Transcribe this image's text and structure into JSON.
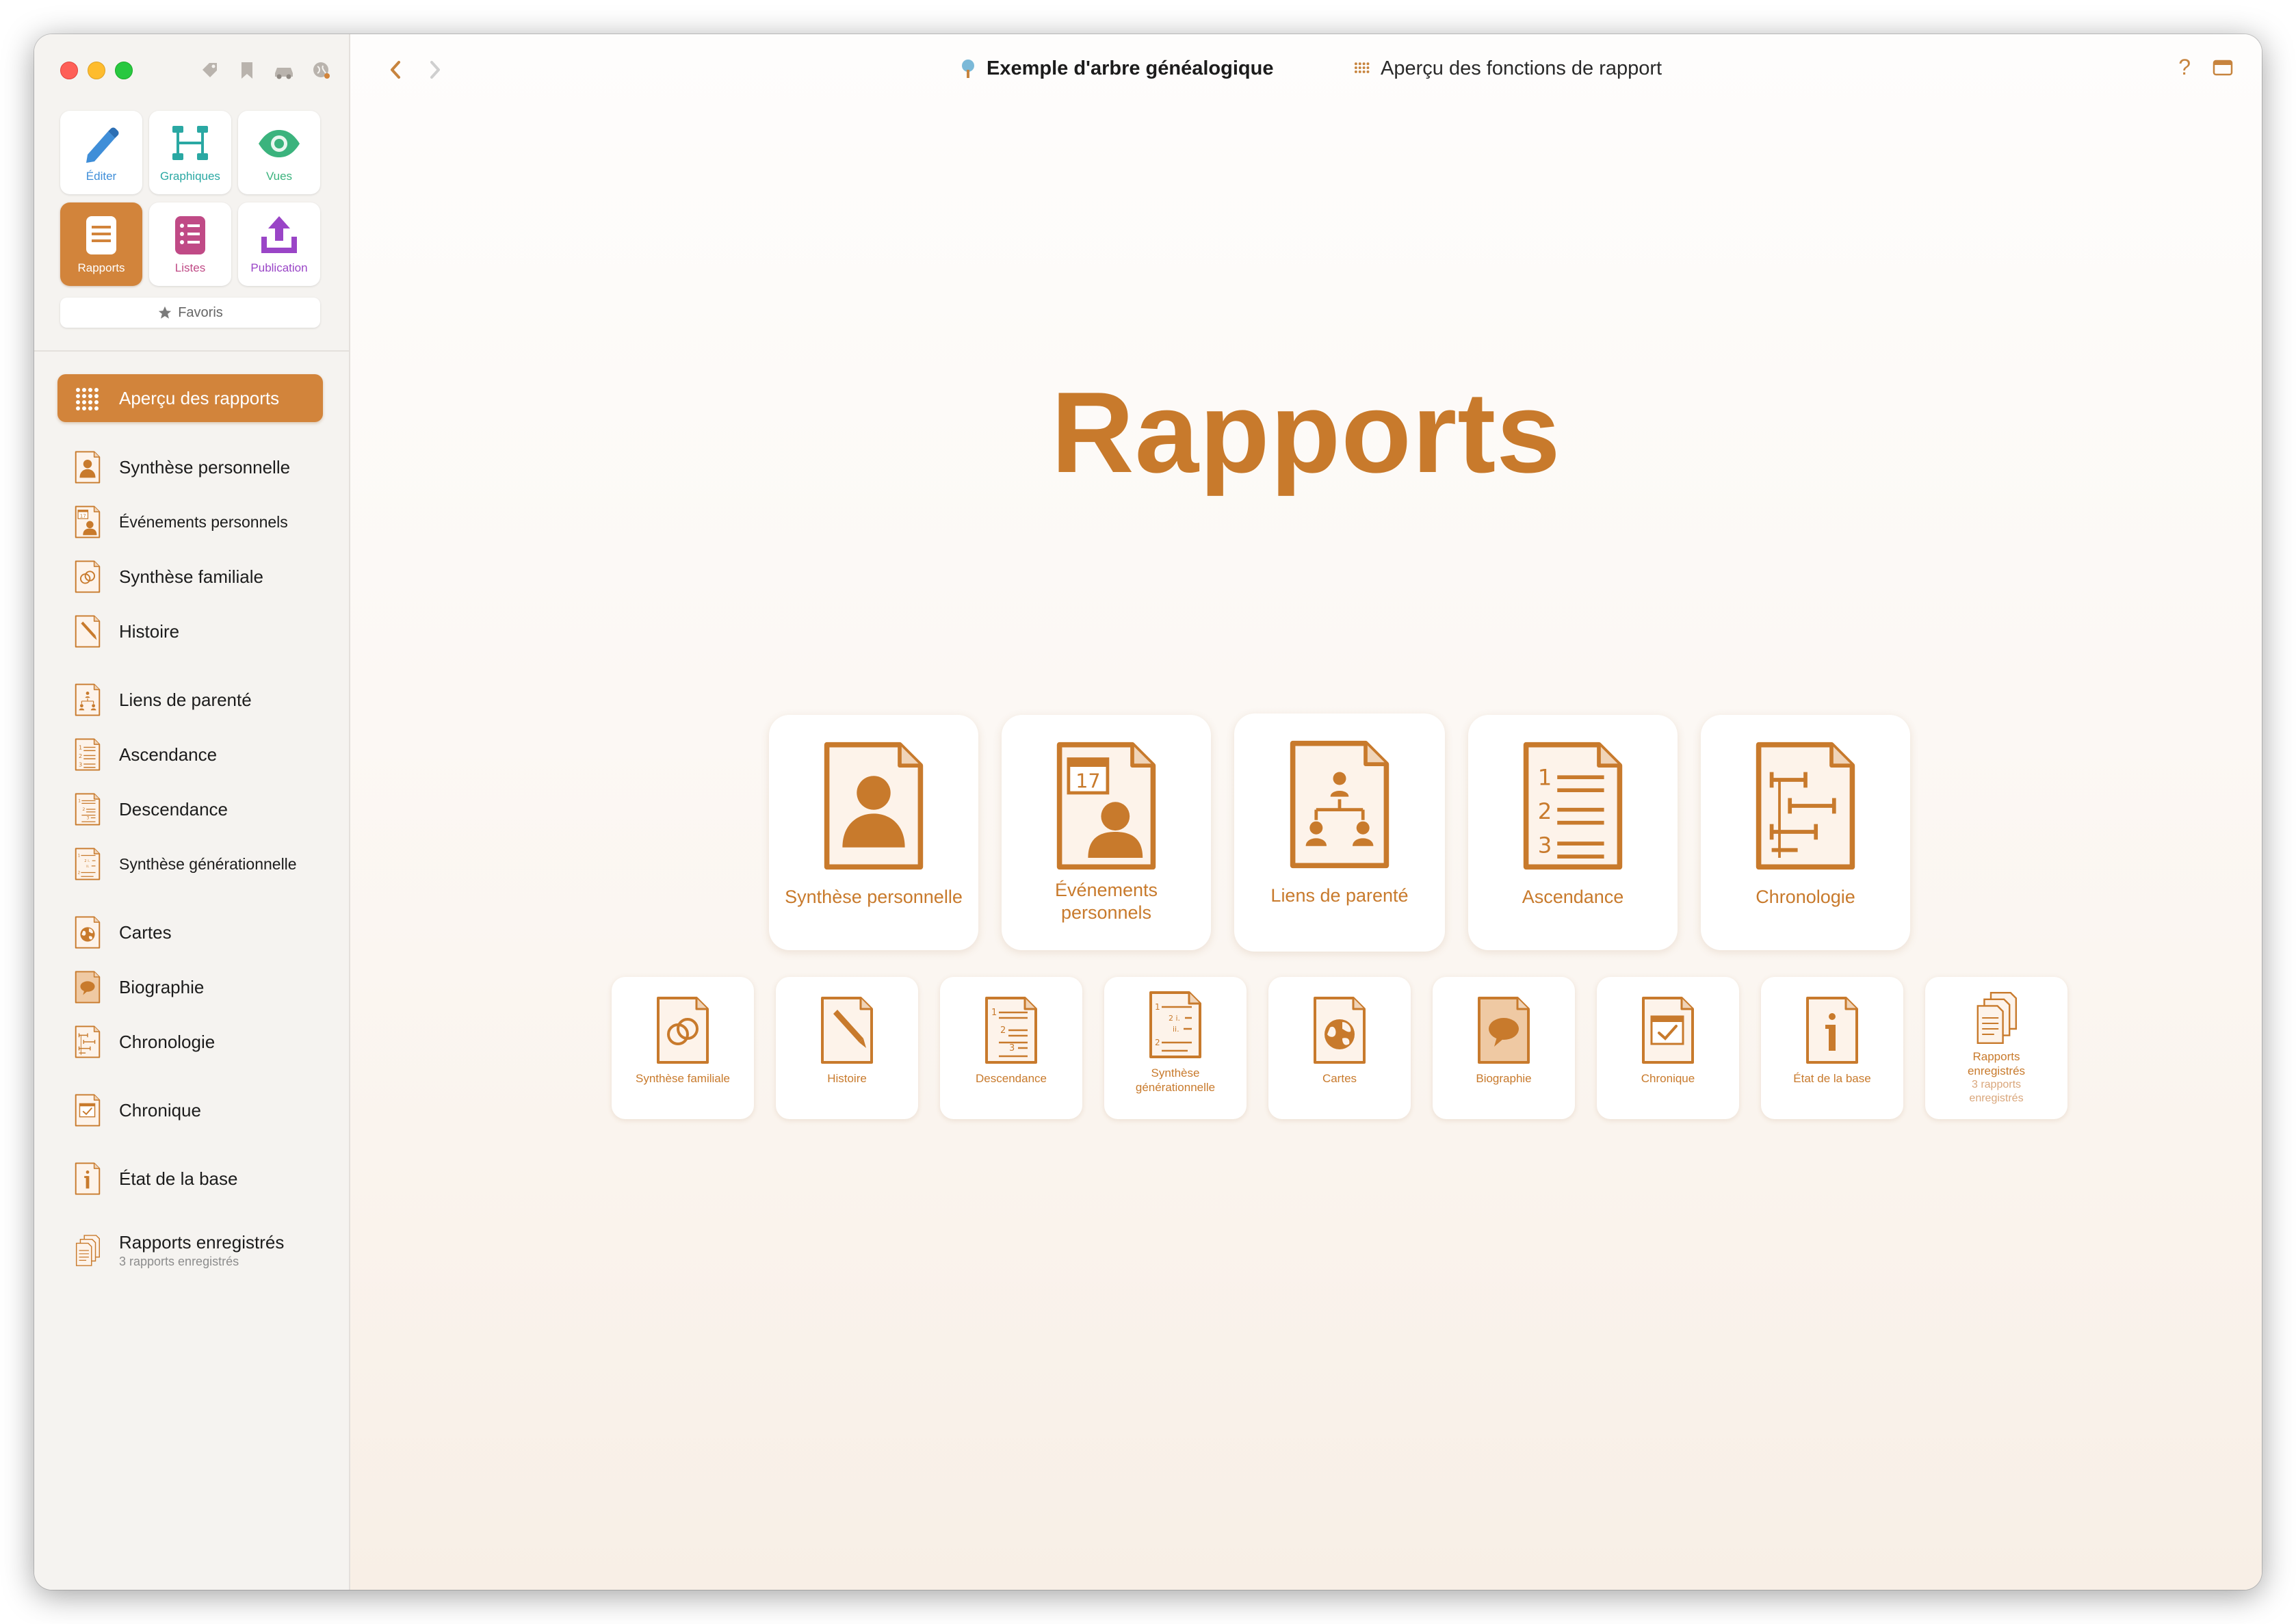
{
  "window": {
    "breadcrumb_tree": "Exemple d'arbre généalogique",
    "breadcrumb_page": "Aperçu des fonctions de rapport",
    "help": "?"
  },
  "colors": {
    "accent": "#d2843b",
    "accent_text": "#c87a2c",
    "sidebar_bg": "#f5f3f0"
  },
  "modes": [
    {
      "label": "Éditer",
      "icon": "pencil-icon",
      "color": "#3f8ed8"
    },
    {
      "label": "Graphiques",
      "icon": "chart-tree-icon",
      "color": "#2aa8a3"
    },
    {
      "label": "Vues",
      "icon": "eye-icon",
      "color": "#3bb37d"
    },
    {
      "label": "Rapports",
      "icon": "document-icon",
      "color": "#ffffff",
      "active": true
    },
    {
      "label": "Listes",
      "icon": "list-icon",
      "color": "#c04a86"
    },
    {
      "label": "Publication",
      "icon": "upload-icon",
      "color": "#9a45c7"
    }
  ],
  "favoris": "Favoris",
  "sidebar": {
    "items": [
      {
        "label": "Aperçu des rapports",
        "icon": "grid-icon",
        "active": true
      },
      {
        "label": "Synthèse personnelle",
        "icon": "person-report-icon"
      },
      {
        "label": "Événements personnels",
        "icon": "person-events-icon"
      },
      {
        "label": "Synthèse familiale",
        "icon": "rings-report-icon"
      },
      {
        "label": "Histoire",
        "icon": "pencil-report-icon"
      },
      {
        "label": "Liens de parenté",
        "icon": "relations-report-icon"
      },
      {
        "label": "Ascendance",
        "icon": "ancestors-report-icon"
      },
      {
        "label": "Descendance",
        "icon": "descendants-report-icon"
      },
      {
        "label": "Synthèse générationnelle",
        "icon": "generations-report-icon"
      },
      {
        "label": "Cartes",
        "icon": "globe-report-icon"
      },
      {
        "label": "Biographie",
        "icon": "speech-report-icon"
      },
      {
        "label": "Chronologie",
        "icon": "timeline-report-icon"
      },
      {
        "label": "Chronique",
        "icon": "calendar-check-report-icon"
      },
      {
        "label": "État de la base",
        "icon": "info-report-icon"
      },
      {
        "label": "Rapports enregistrés",
        "sub": "3 rapports enregistrés",
        "icon": "stacked-reports-icon"
      }
    ]
  },
  "main": {
    "title": "Rapports",
    "featured": [
      {
        "label": "Synthèse personnelle",
        "icon": "person-report-icon"
      },
      {
        "label": "Événements personnels",
        "icon": "person-events-icon",
        "calendar_day": "17"
      },
      {
        "label": "Liens de parenté",
        "icon": "relations-report-icon"
      },
      {
        "label": "Ascendance",
        "icon": "ancestors-report-icon",
        "numbers": [
          "1",
          "2",
          "3"
        ]
      },
      {
        "label": "Chronologie",
        "icon": "timeline-report-icon"
      }
    ],
    "secondary": [
      {
        "label": "Synthèse familiale",
        "icon": "rings-report-icon"
      },
      {
        "label": "Histoire",
        "icon": "pencil-report-icon"
      },
      {
        "label": "Descendance",
        "icon": "descendants-report-icon"
      },
      {
        "label": "Synthèse générationnelle",
        "icon": "generations-report-icon"
      },
      {
        "label": "Cartes",
        "icon": "globe-report-icon"
      },
      {
        "label": "Biographie",
        "icon": "speech-report-icon"
      },
      {
        "label": "Chronique",
        "icon": "calendar-check-report-icon"
      },
      {
        "label": "État de la base",
        "icon": "info-report-icon"
      },
      {
        "label": "Rapports enregistrés",
        "sub": "3 rapports enregistrés",
        "icon": "stacked-reports-icon"
      }
    ]
  }
}
